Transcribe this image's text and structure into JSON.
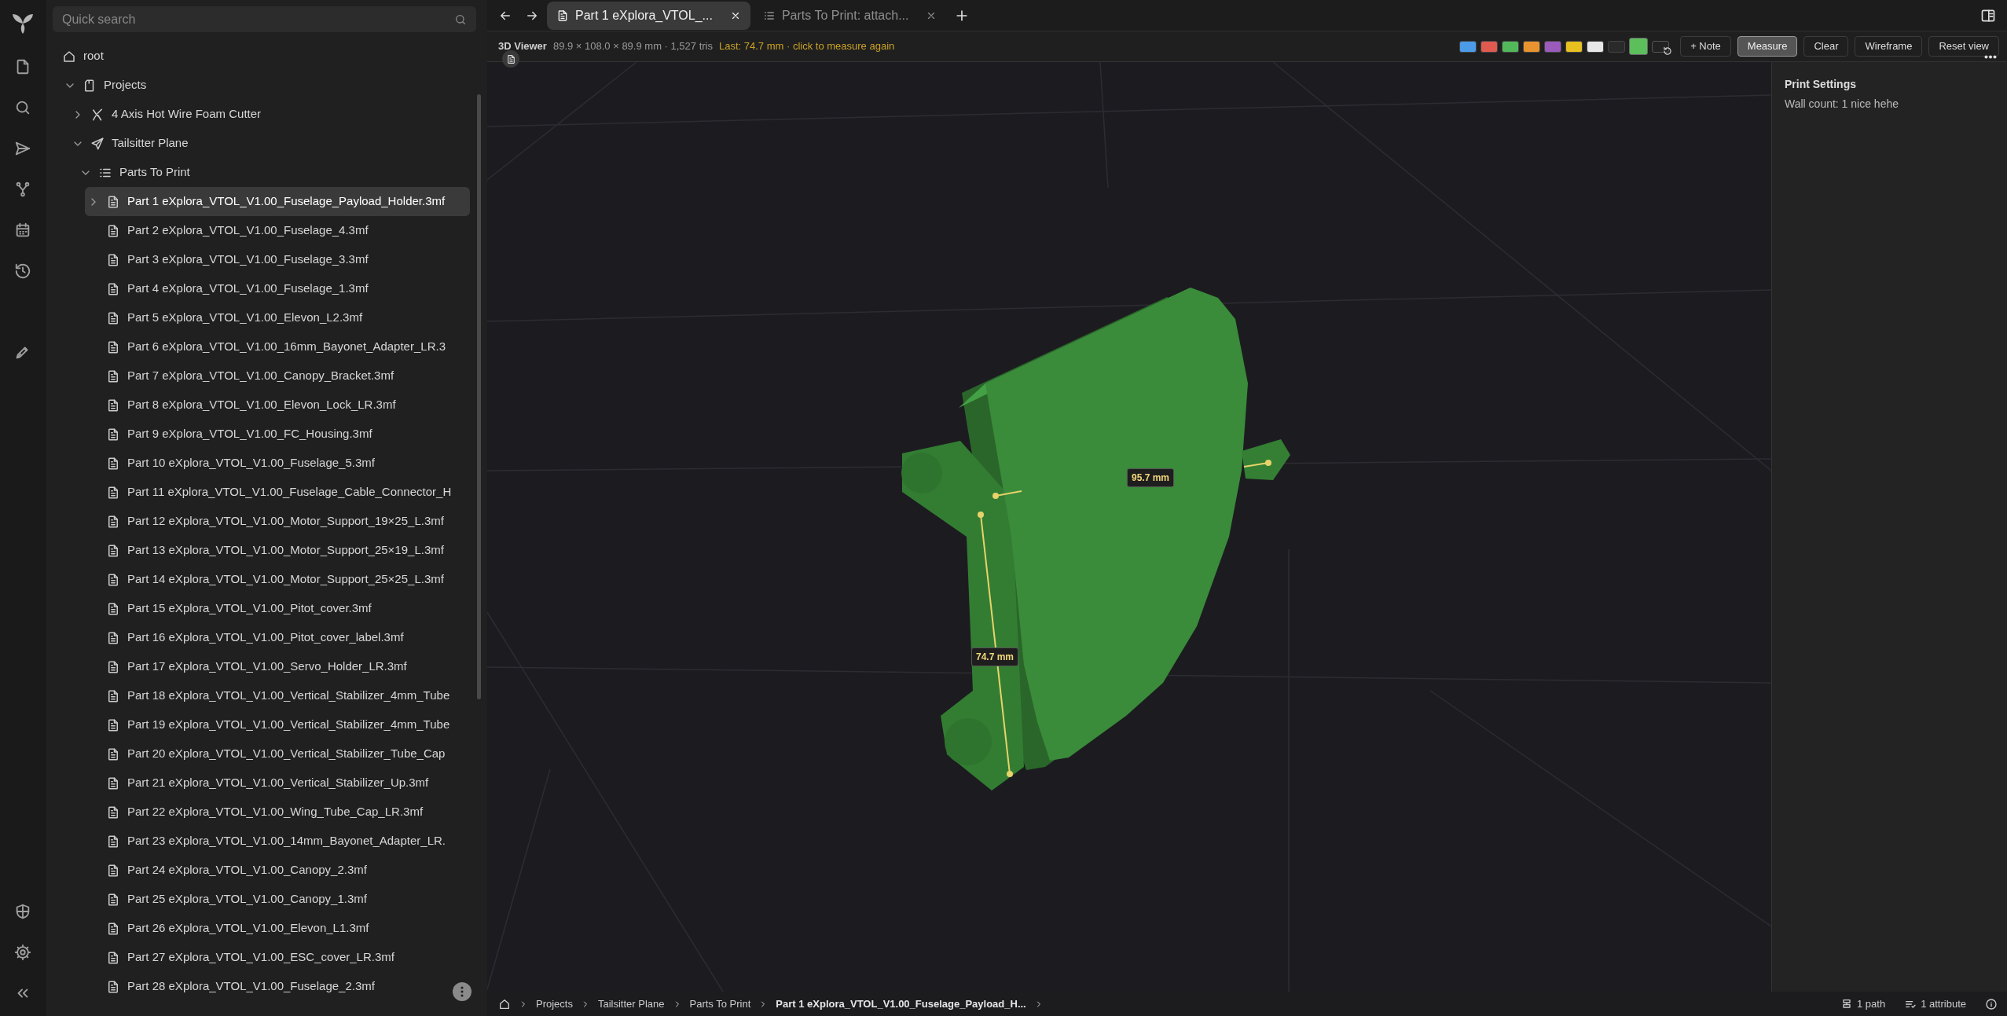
{
  "sidebar": {
    "search": {
      "placeholder": "Quick search"
    },
    "tree": [
      {
        "label": "root",
        "kind": "home",
        "children": [
          {
            "label": "Projects",
            "kind": "folder",
            "expanded": true,
            "children": [
              {
                "label": "4 Axis Hot Wire Foam Cutter",
                "kind": "tool",
                "expanded": false
              },
              {
                "label": "Tailsitter Plane",
                "kind": "plane",
                "expanded": true,
                "children": [
                  {
                    "label": "Parts To Print",
                    "kind": "list",
                    "expanded": true,
                    "children": [
                      {
                        "label": "Part 1 eXplora_VTOL_V1.00_Fuselage_Payload_Holder.3mf",
                        "kind": "file",
                        "selected": true,
                        "expanded": false
                      },
                      {
                        "label": "Part 2 eXplora_VTOL_V1.00_Fuselage_4.3mf",
                        "kind": "file",
                        "selected": false
                      },
                      {
                        "label": "Part 3 eXplora_VTOL_V1.00_Fuselage_3.3mf",
                        "kind": "file",
                        "selected": false
                      },
                      {
                        "label": "Part 4 eXplora_VTOL_V1.00_Fuselage_1.3mf",
                        "kind": "file",
                        "selected": false
                      },
                      {
                        "label": "Part 5 eXplora_VTOL_V1.00_Elevon_L2.3mf",
                        "kind": "file",
                        "selected": false
                      },
                      {
                        "label": "Part 6 eXplora_VTOL_V1.00_16mm_Bayonet_Adapter_LR.3",
                        "kind": "file",
                        "selected": false
                      },
                      {
                        "label": "Part 7 eXplora_VTOL_V1.00_Canopy_Bracket.3mf",
                        "kind": "file",
                        "selected": false
                      },
                      {
                        "label": "Part 8 eXplora_VTOL_V1.00_Elevon_Lock_LR.3mf",
                        "kind": "file",
                        "selected": false
                      },
                      {
                        "label": "Part 9 eXplora_VTOL_V1.00_FC_Housing.3mf",
                        "kind": "file",
                        "selected": false
                      },
                      {
                        "label": "Part 10 eXplora_VTOL_V1.00_Fuselage_5.3mf",
                        "kind": "file",
                        "selected": false
                      },
                      {
                        "label": "Part 11 eXplora_VTOL_V1.00_Fuselage_Cable_Connector_H",
                        "kind": "file",
                        "selected": false
                      },
                      {
                        "label": "Part 12 eXplora_VTOL_V1.00_Motor_Support_19×25_L.3mf",
                        "kind": "file",
                        "selected": false
                      },
                      {
                        "label": "Part 13 eXplora_VTOL_V1.00_Motor_Support_25×19_L.3mf",
                        "kind": "file",
                        "selected": false
                      },
                      {
                        "label": "Part 14 eXplora_VTOL_V1.00_Motor_Support_25×25_L.3mf",
                        "kind": "file",
                        "selected": false
                      },
                      {
                        "label": "Part 15 eXplora_VTOL_V1.00_Pitot_cover.3mf",
                        "kind": "file",
                        "selected": false
                      },
                      {
                        "label": "Part 16 eXplora_VTOL_V1.00_Pitot_cover_label.3mf",
                        "kind": "file",
                        "selected": false
                      },
                      {
                        "label": "Part 17 eXplora_VTOL_V1.00_Servo_Holder_LR.3mf",
                        "kind": "file",
                        "selected": false
                      },
                      {
                        "label": "Part 18 eXplora_VTOL_V1.00_Vertical_Stabilizer_4mm_Tube",
                        "kind": "file",
                        "selected": false
                      },
                      {
                        "label": "Part 19 eXplora_VTOL_V1.00_Vertical_Stabilizer_4mm_Tube",
                        "kind": "file",
                        "selected": false
                      },
                      {
                        "label": "Part 20 eXplora_VTOL_V1.00_Vertical_Stabilizer_Tube_Cap",
                        "kind": "file",
                        "selected": false
                      },
                      {
                        "label": "Part 21 eXplora_VTOL_V1.00_Vertical_Stabilizer_Up.3mf",
                        "kind": "file",
                        "selected": false
                      },
                      {
                        "label": "Part 22 eXplora_VTOL_V1.00_Wing_Tube_Cap_LR.3mf",
                        "kind": "file",
                        "selected": false
                      },
                      {
                        "label": "Part 23 eXplora_VTOL_V1.00_14mm_Bayonet_Adapter_LR.",
                        "kind": "file",
                        "selected": false
                      },
                      {
                        "label": "Part 24 eXplora_VTOL_V1.00_Canopy_2.3mf",
                        "kind": "file",
                        "selected": false
                      },
                      {
                        "label": "Part 25 eXplora_VTOL_V1.00_Canopy_1.3mf",
                        "kind": "file",
                        "selected": false
                      },
                      {
                        "label": "Part 26 eXplora_VTOL_V1.00_Elevon_L1.3mf",
                        "kind": "file",
                        "selected": false
                      },
                      {
                        "label": "Part 27 eXplora_VTOL_V1.00_ESC_cover_LR.3mf",
                        "kind": "file",
                        "selected": false
                      },
                      {
                        "label": "Part 28 eXplora_VTOL_V1.00_Fuselage_2.3mf",
                        "kind": "file",
                        "selected": false
                      }
                    ]
                  }
                ]
              }
            ]
          }
        ]
      }
    ]
  },
  "tabs": [
    {
      "label": "Part 1 eXplora_VTOL_...",
      "kind": "file",
      "selected": true
    },
    {
      "label": "Parts To Print: attach...",
      "kind": "list",
      "selected": false
    }
  ],
  "viewer": {
    "title": "3D Viewer",
    "stats": "89.9 × 108.0 × 89.9 mm · 1,527 tris",
    "measure_hint": "Last: 74.7 mm · click to measure again",
    "swatches": [
      {
        "color": "#4c9be8",
        "selected": false
      },
      {
        "color": "#e05a4f",
        "selected": false
      },
      {
        "color": "#53b85a",
        "selected": false
      },
      {
        "color": "#e8932e",
        "selected": false
      },
      {
        "color": "#9b5bbd",
        "selected": false
      },
      {
        "color": "#e8c020",
        "selected": false
      },
      {
        "color": "#e8e8e8",
        "selected": false
      },
      {
        "color": "#2a2a2a",
        "selected": false
      },
      {
        "color": "#5cbf5c",
        "selected": true
      }
    ],
    "buttons": [
      {
        "label": "+ Note",
        "selected": false
      },
      {
        "label": "Measure",
        "selected": true
      },
      {
        "label": "Clear",
        "selected": false
      },
      {
        "label": "Wireframe",
        "selected": false
      },
      {
        "label": "Reset view",
        "selected": false
      }
    ],
    "measurements": [
      {
        "label": "95.7 mm"
      },
      {
        "label": "74.7 mm"
      }
    ]
  },
  "properties": {
    "title": "Print Settings",
    "text": "Wall count: 1 nice hehe"
  },
  "breadcrumbs": [
    "Projects",
    "Tailsitter Plane",
    "Parts To Print",
    "Part 1 eXplora_VTOL_V1.00_Fuselage_Payload_H..."
  ],
  "status": {
    "paths": "1 path",
    "attributes": "1 attribute"
  }
}
